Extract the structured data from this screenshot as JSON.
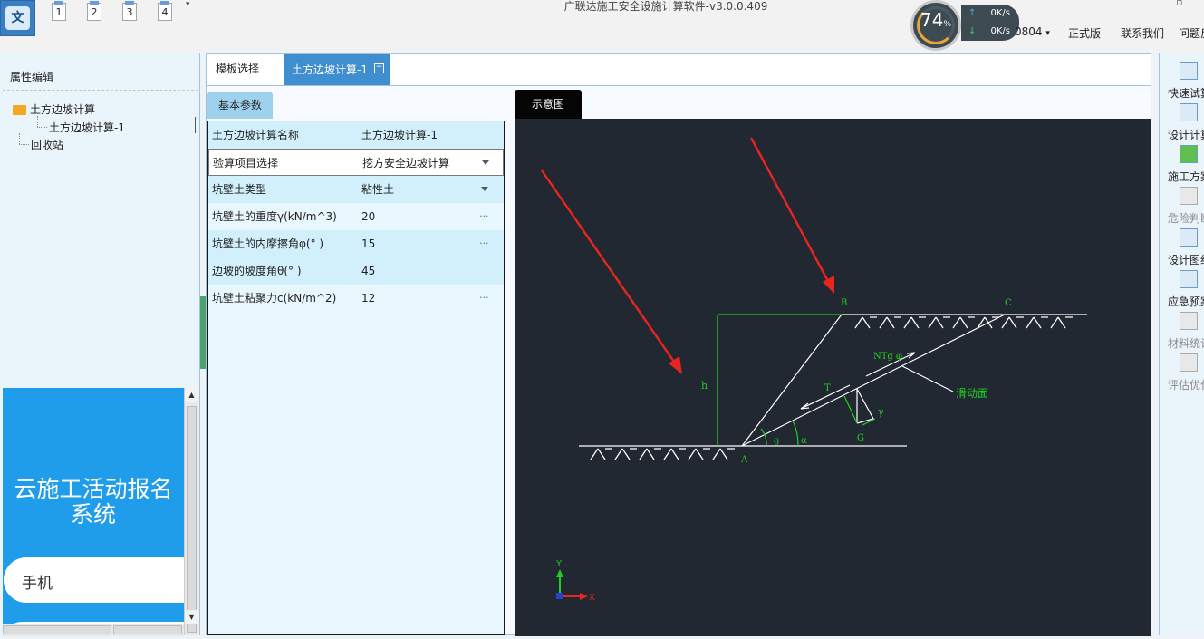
{
  "window": {
    "title": "广联达施工安全设施计算软件-v3.0.0.409",
    "app_logo_char": "文",
    "quick_access": [
      "1",
      "2",
      "3",
      "4"
    ],
    "quick_access_more": "▾",
    "restore_glyph": "▫"
  },
  "network_widget": {
    "percent": "74",
    "percent_unit": "%",
    "up_speed": "0K/s",
    "down_speed": "0K/s"
  },
  "menu": {
    "user_fragment": "0804",
    "user_dropdown": "▾",
    "pro": "正式版",
    "contact": "联系我们",
    "faq": "问题反"
  },
  "left_panel": {
    "header": "属性编辑",
    "tree": {
      "root": "土方边坡计算",
      "child": "土方边坡计算-1",
      "recycle": "回收站"
    },
    "ad": {
      "title_line1": "云施工活动报名",
      "title_line2": "系统",
      "phone_placeholder": "手机"
    }
  },
  "tabs": {
    "template": "模板选择",
    "active": "土方边坡计算-1",
    "close_glyph": "−"
  },
  "params": {
    "tab_label": "基本参数",
    "rows": [
      {
        "label": "土方边坡计算名称",
        "value": "土方边坡计算-1",
        "control": "none"
      },
      {
        "label": "验算项目选择",
        "value": "挖方安全边坡计算",
        "control": "dropdown"
      },
      {
        "label": "坑壁土类型",
        "value": "粘性土",
        "control": "dropdown"
      },
      {
        "label": "坑壁土的重度γ(kN/m^3)",
        "value": "20",
        "control": "ellipsis"
      },
      {
        "label": "坑壁土的内摩擦角φ(° )",
        "value": "15",
        "control": "ellipsis"
      },
      {
        "label": "边坡的坡度角θ(° )",
        "value": "45",
        "control": "none"
      },
      {
        "label": "坑壁土粘聚力c(kN/m^2)",
        "value": "12",
        "control": "ellipsis"
      }
    ],
    "ellipsis_glyph": "···"
  },
  "diagram": {
    "tab_label": "示意图",
    "labels": {
      "a": "A",
      "b": "B",
      "c": "C",
      "h": "h",
      "t": "T",
      "g": "G",
      "gamma": "γ",
      "theta": "θ",
      "alpha": "α",
      "ntg": "NTg φ",
      "slide_plane": "滑动面",
      "axis_x": "X",
      "axis_y": "Y"
    },
    "colors": {
      "background": "#222831",
      "line": "#ffffff",
      "green": "#1fd11f",
      "red_arrow": "#e8251f"
    }
  },
  "right_toolbar": [
    {
      "label": "快速试算",
      "enabled": true
    },
    {
      "label": "设计计算",
      "enabled": true
    },
    {
      "label": "施工方案",
      "enabled": true
    },
    {
      "label": "危险判断",
      "enabled": false
    },
    {
      "label": "设计图纸",
      "enabled": true
    },
    {
      "label": "应急预案",
      "enabled": true
    },
    {
      "label": "材料统计",
      "enabled": false
    },
    {
      "label": "评估优化",
      "enabled": false
    }
  ]
}
